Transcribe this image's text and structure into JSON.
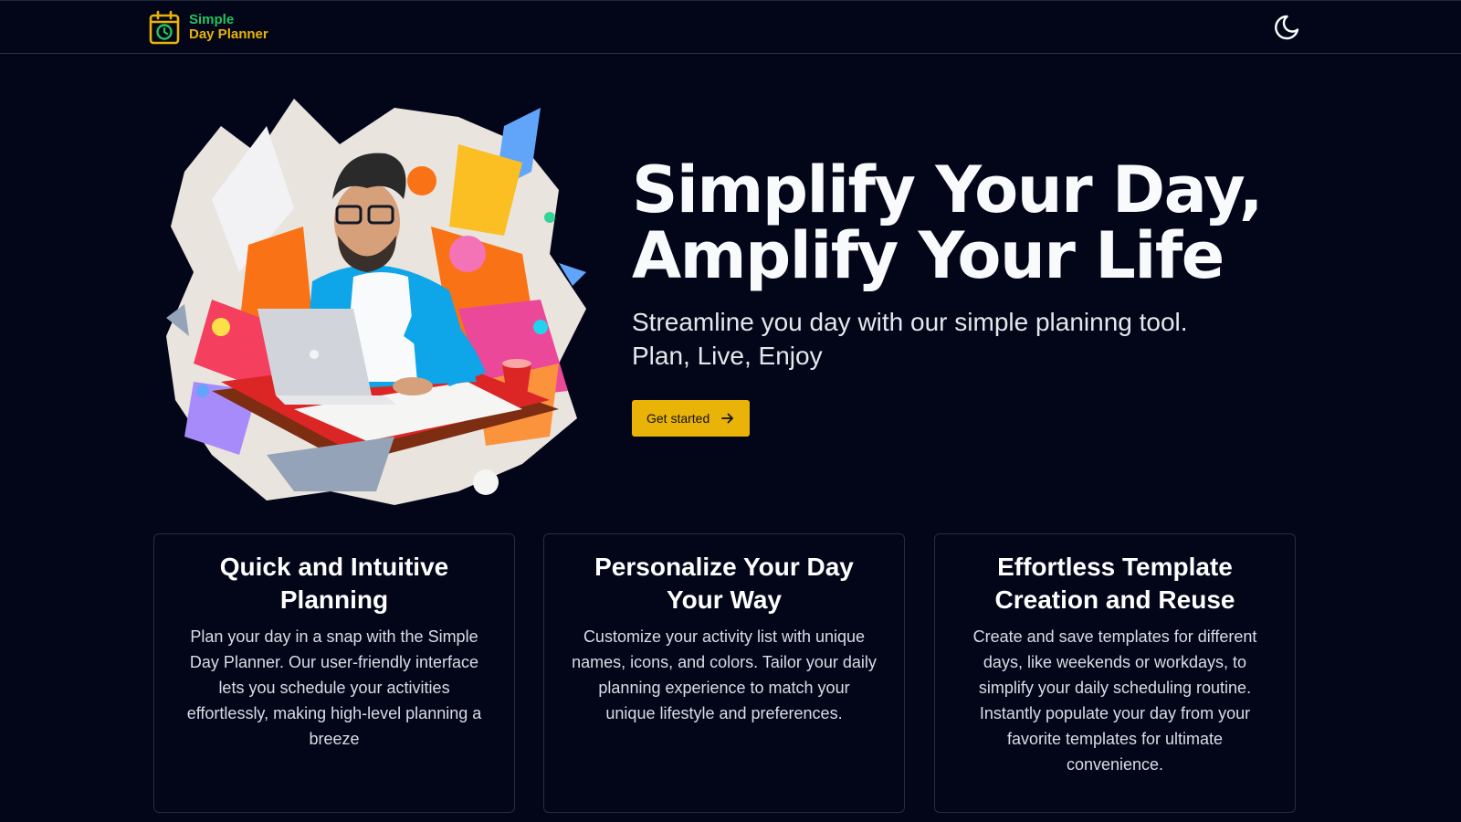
{
  "header": {
    "logo_line1": "Simple",
    "logo_line2": "Day Planner",
    "logo_icon": "calendar-clock-icon",
    "theme_toggle_icon": "moon-icon"
  },
  "hero": {
    "image_subject": "illustration of a bearded man with glasses working on a laptop amid colorful paint splashes",
    "title_line1": "Simplify Your Day,",
    "title_line2": "Amplify Your Life",
    "subtitle_line1": "Streamline you day with our simple planinng tool.",
    "subtitle_line2": "Plan, Live, Enjoy",
    "cta_label": "Get started",
    "cta_icon": "arrow-right-icon"
  },
  "features": [
    {
      "title": "Quick and Intuitive Planning",
      "body": "Plan your day in a snap with the Simple Day Planner. Our user-friendly interface lets you schedule your activities effortlessly, making high-level planning a breeze"
    },
    {
      "title": "Personalize Your Day Your Way",
      "body": "Customize your activity list with unique names, icons, and colors. Tailor your daily planning experience to match your unique lifestyle and preferences."
    },
    {
      "title": "Effortless Template Creation and Reuse",
      "body": "Create and save templates for different days, like weekends or workdays, to simplify your daily scheduling routine. Instantly populate your day from your favorite templates for ultimate convenience."
    }
  ],
  "colors": {
    "background": "#030619",
    "accent_yellow": "#eab308",
    "accent_green": "#22c55e",
    "card_border": "#262d3b"
  }
}
